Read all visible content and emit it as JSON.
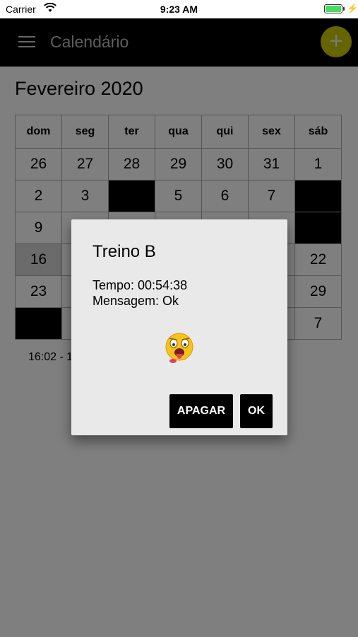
{
  "status_bar": {
    "carrier": "Carrier",
    "time": "9:23 AM"
  },
  "app_bar": {
    "title": "Calendário",
    "add_label": "+"
  },
  "calendar": {
    "month_title": "Fevereiro 2020",
    "weekdays": [
      "dom",
      "seg",
      "ter",
      "qua",
      "qui",
      "sex",
      "sáb"
    ],
    "weeks": [
      [
        "26",
        "27",
        "28",
        "29",
        "30",
        "31",
        "1"
      ],
      [
        "2",
        "3",
        "",
        "5",
        "6",
        "7",
        ""
      ],
      [
        "9",
        "",
        "",
        "",
        "",
        "",
        ""
      ],
      [
        "16",
        "",
        "",
        "",
        "",
        "",
        "22"
      ],
      [
        "23",
        "",
        "",
        "",
        "",
        "",
        "29"
      ],
      [
        "",
        "",
        "",
        "",
        "",
        "",
        "7"
      ]
    ]
  },
  "event_line": "16:02 - 1",
  "dialog": {
    "title": "Treino B",
    "tempo": "Tempo: 00:54:38",
    "mensagem": "Mensagem: Ok",
    "delete_label": "APAGAR",
    "ok_label": "OK"
  },
  "colors": {
    "accent": "#c8c800",
    "app_bar": "#000000",
    "battery": "#4cd964"
  }
}
